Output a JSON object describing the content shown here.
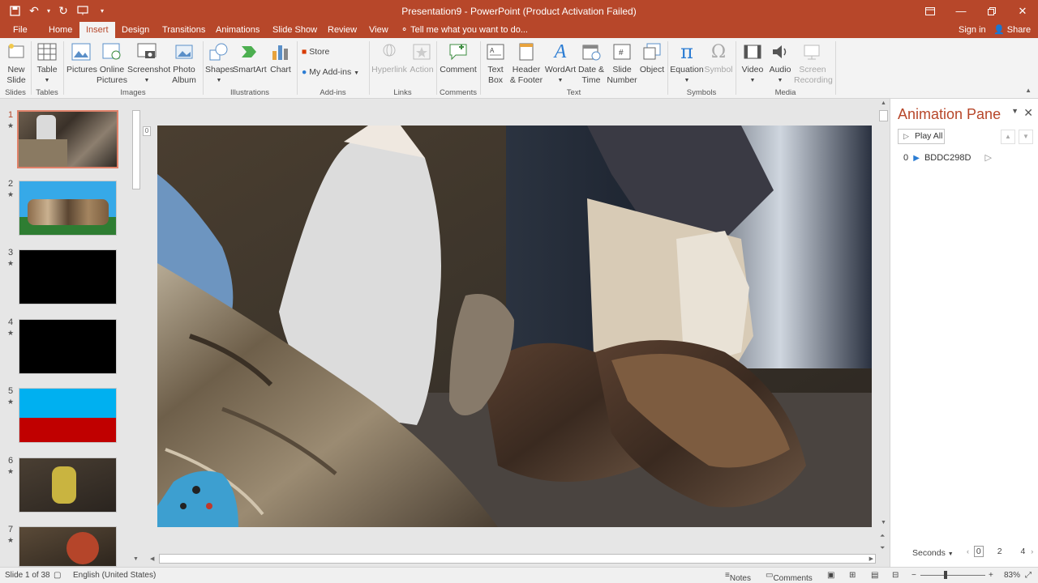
{
  "window": {
    "title": "Presentation9 - PowerPoint (Product Activation Failed)",
    "accent": "#b7472a"
  },
  "tabs": [
    {
      "label": "File"
    },
    {
      "label": "Home"
    },
    {
      "label": "Insert",
      "active": true
    },
    {
      "label": "Design"
    },
    {
      "label": "Transitions"
    },
    {
      "label": "Animations"
    },
    {
      "label": "Slide Show"
    },
    {
      "label": "Review"
    },
    {
      "label": "View"
    }
  ],
  "tell_me": "Tell me what you want to do...",
  "sign_in": "Sign in",
  "share": "Share",
  "ribbon": {
    "new_slide": "New\nSlide",
    "table": "Table",
    "pictures": "Pictures",
    "online_pictures": "Online\nPictures",
    "screenshot": "Screenshot",
    "photo_album": "Photo\nAlbum",
    "shapes": "Shapes",
    "smartart": "SmartArt",
    "chart": "Chart",
    "store": "Store",
    "my_addins": "My Add-ins",
    "hyperlink": "Hyperlink",
    "action": "Action",
    "comment": "Comment",
    "text_box": "Text\nBox",
    "header_footer": "Header\n& Footer",
    "wordart": "WordArt",
    "date_time": "Date &\nTime",
    "slide_number": "Slide\nNumber",
    "object": "Object",
    "equation": "Equation",
    "symbol": "Symbol",
    "video": "Video",
    "audio": "Audio",
    "screen_recording": "Screen\nRecording",
    "groups": {
      "slides": "Slides",
      "tables": "Tables",
      "images": "Images",
      "illustrations": "Illustrations",
      "addins": "Add-ins",
      "links": "Links",
      "comments": "Comments",
      "text": "Text",
      "symbols": "Symbols",
      "media": "Media"
    }
  },
  "thumbnails": [
    {
      "num": "1",
      "star": "★"
    },
    {
      "num": "2",
      "star": "★"
    },
    {
      "num": "3",
      "star": "★"
    },
    {
      "num": "4",
      "star": "★"
    },
    {
      "num": "5",
      "star": "★"
    },
    {
      "num": "6",
      "star": "★"
    },
    {
      "num": "7",
      "star": "★"
    }
  ],
  "animation_pane": {
    "title": "Animation Pane",
    "play_all": "Play All",
    "item_index": "0",
    "item_name": "BDDC298D",
    "seconds": "Seconds",
    "timeline": [
      "0",
      "2",
      "4"
    ]
  },
  "status": {
    "slide": "Slide 1 of 38",
    "language": "English (United States)",
    "notes": "Notes",
    "comments": "Comments",
    "zoom": "83%"
  }
}
